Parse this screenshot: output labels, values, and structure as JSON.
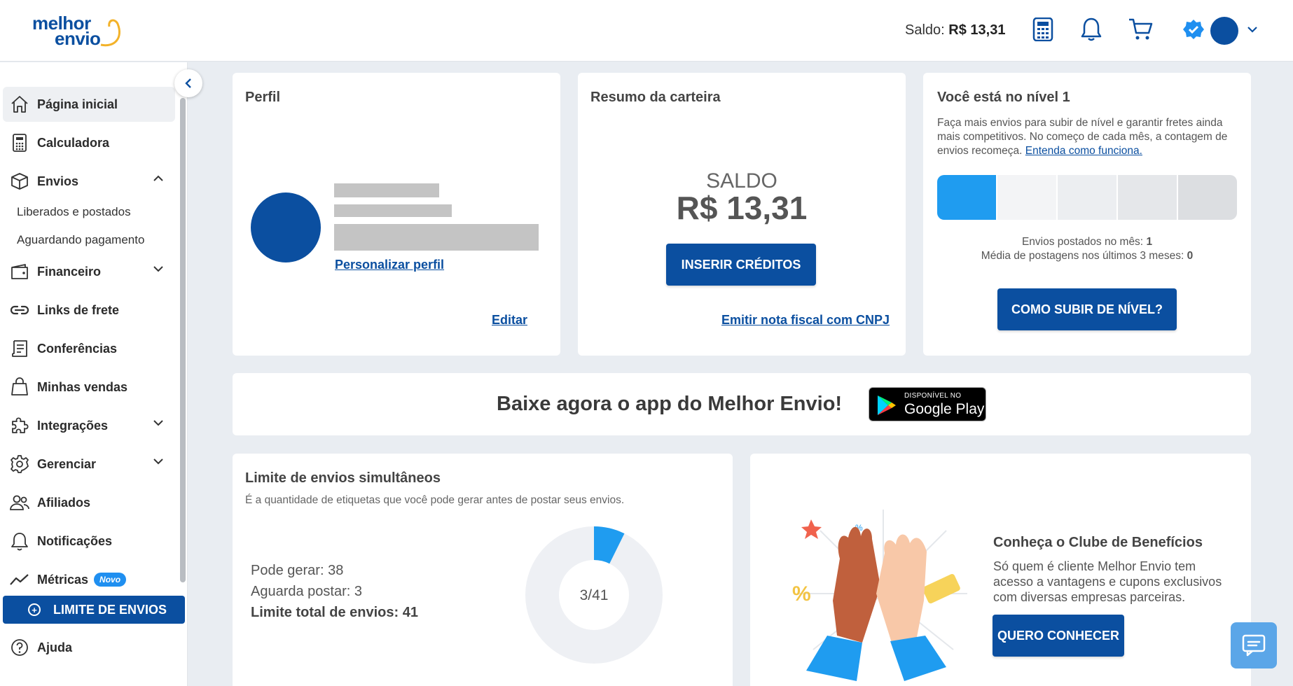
{
  "header": {
    "logo_line1": "melhor",
    "logo_line2": "envio",
    "saldo_label": "Saldo:",
    "saldo_value": "R$ 13,31",
    "icons": [
      "calculator-icon",
      "bell-icon",
      "cart-icon",
      "verified-icon",
      "avatar",
      "chevron-down-icon"
    ]
  },
  "sidebar": {
    "items": [
      {
        "label": "Página inicial",
        "icon": "home-icon",
        "active": true
      },
      {
        "label": "Calculadora",
        "icon": "calculator-icon"
      },
      {
        "label": "Envios",
        "icon": "box-icon",
        "expanded": true
      },
      {
        "label": "Financeiro",
        "icon": "wallet-icon"
      },
      {
        "label": "Links de frete",
        "icon": "link-icon"
      },
      {
        "label": "Conferências",
        "icon": "receipt-icon"
      },
      {
        "label": "Minhas vendas",
        "icon": "bag-icon"
      },
      {
        "label": "Integrações",
        "icon": "puzzle-icon"
      },
      {
        "label": "Gerenciar",
        "icon": "gear-icon"
      },
      {
        "label": "Afiliados",
        "icon": "users-icon"
      },
      {
        "label": "Notificações",
        "icon": "bell-icon"
      },
      {
        "label": "Métricas",
        "icon": "chart-line-icon",
        "badge": "Novo"
      },
      {
        "label": "Ajuda",
        "icon": "help-icon"
      }
    ],
    "envios_sub": [
      "Liberados e postados",
      "Aguardando pagamento"
    ],
    "limite_button": "LIMITE DE ENVIOS"
  },
  "perfil": {
    "title": "Perfil",
    "personalize_link": "Personalizar perfil",
    "edit_link": "Editar"
  },
  "carteira": {
    "title": "Resumo da carteira",
    "saldo_label": "SALDO",
    "saldo_value": "R$ 13,31",
    "insert_button": "INSERIR CRÉDITOS",
    "nota_link": "Emitir nota fiscal com CNPJ"
  },
  "nivel": {
    "title": "Você está no nível 1",
    "description": "Faça mais envios para subir de nível e garantir fretes ainda mais competitivos. No começo de cada mês, a contagem de envios recomeça.",
    "link": "Entenda como funciona.",
    "levels_total": 5,
    "level_current": 1,
    "stats_line1_label": "Envios postados no mês:",
    "stats_line1_value": "1",
    "stats_line2_label": "Média de postagens nos últimos 3 meses:",
    "stats_line2_value": "0",
    "button": "COMO SUBIR DE NÍVEL?"
  },
  "app_banner": {
    "text": "Baixe agora o app do Melhor Envio!",
    "badge_small": "DISPONÍVEL NO",
    "badge_big": "Google Play"
  },
  "limite": {
    "title": "Limite de envios simultâneos",
    "subtitle": "É a quantidade de etiquetas que você pode gerar antes de postar seus envios.",
    "pode_gerar": "Pode gerar: 38",
    "aguarda_postar": "Aguarda postar: 3",
    "limite_total": "Limite total de envios: 41",
    "donut_label": "3/41",
    "used": 3,
    "total": 41
  },
  "clube": {
    "title": "Conheça o Clube de Benefícios",
    "text": "Só quem é cliente Melhor Envio tem acesso a vantagens e cupons exclusivos com diversas empresas parceiras.",
    "button": "QUERO CONHECER"
  },
  "colors": {
    "primary": "#0b4fa0",
    "accent": "#1f9cf0",
    "bg": "#e9edf2"
  }
}
